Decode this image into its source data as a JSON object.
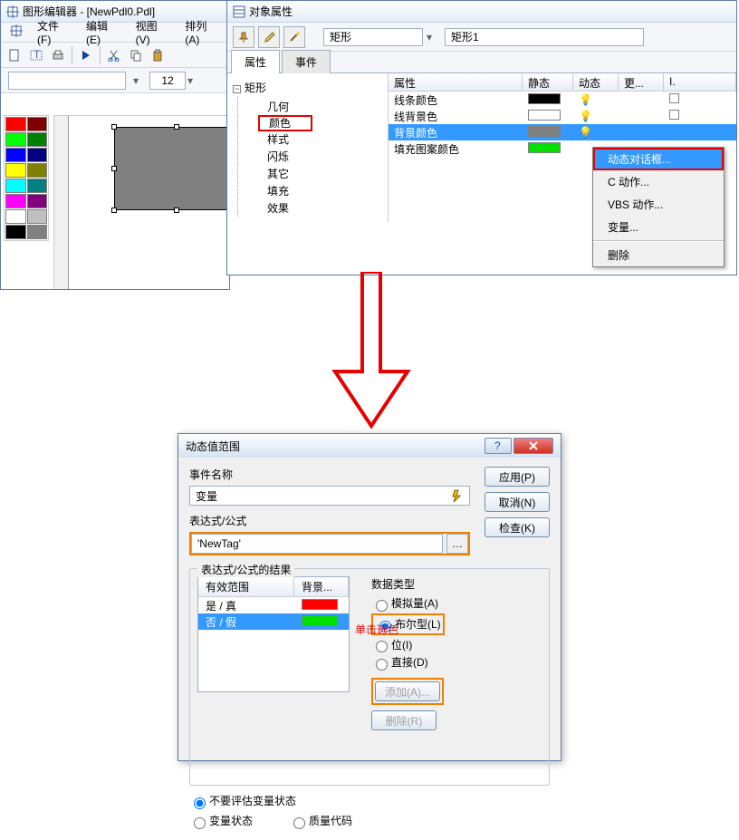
{
  "editor": {
    "title": "图形编辑器 - [NewPdl0.Pdl]",
    "menu": {
      "file": "文件(F)",
      "edit": "编辑(E)",
      "view": "视图(V)",
      "arrange": "排列(A)"
    },
    "font_size": "12",
    "palette": [
      "#ff0000",
      "#800000",
      "#00ff00",
      "#008000",
      "#0000ff",
      "#000080",
      "#ffff00",
      "#808000",
      "#00ffff",
      "#008080",
      "#ff00ff",
      "#800080",
      "#ffffff",
      "#c0c0c0",
      "#000000",
      "#808080"
    ]
  },
  "propwin": {
    "title": "对象属性",
    "typefield": "矩形",
    "namefield": "矩形1",
    "tabs": {
      "properties": "属性",
      "events": "事件"
    },
    "tree": {
      "root": "矩形",
      "items": [
        "几何",
        "颜色",
        "样式",
        "闪烁",
        "其它",
        "填充",
        "效果"
      ]
    },
    "table": {
      "cols": {
        "attr": "属性",
        "static": "静态",
        "dynamic": "动态",
        "more": "更...",
        "i": "I."
      },
      "rows": [
        {
          "name": "线条颜色",
          "color": "#000000"
        },
        {
          "name": "线背景色",
          "color": "#ffffff"
        },
        {
          "name": "背景颜色",
          "color": "#808080",
          "selected": true
        },
        {
          "name": "填充图案颜色",
          "color": "#00ff00"
        }
      ]
    },
    "ctx": {
      "item1": "动态对话框...",
      "item2": "C 动作...",
      "item3": "VBS 动作...",
      "item4": "变量...",
      "item5": "删除"
    }
  },
  "dlg": {
    "title": "动态值范围",
    "lbl_event": "事件名称",
    "event_val": "变量",
    "lbl_expr": "表达式/公式",
    "expr_val": "'NewTag'",
    "lbl_result": "表达式/公式的结果",
    "lbl_dtype": "数据类型",
    "btn_apply": "应用(P)",
    "btn_cancel": "取消(N)",
    "btn_check": "检查(K)",
    "btn_add": "添加(A)...",
    "btn_del": "删除(R)",
    "restable": {
      "col1": "有效范围",
      "col2": "背景...",
      "r1": "是 / 真",
      "r2": "否 / 假"
    },
    "radios": {
      "r1": "模拟量(A)",
      "r2": "布尔型(L)",
      "r3": "位(I)",
      "r4": "直接(D)"
    },
    "footer": {
      "noeval": "不要评估变量状态",
      "varstate": "变量状态",
      "qcode": "质量代码"
    }
  },
  "anno": {
    "click_color": "单击选色"
  }
}
